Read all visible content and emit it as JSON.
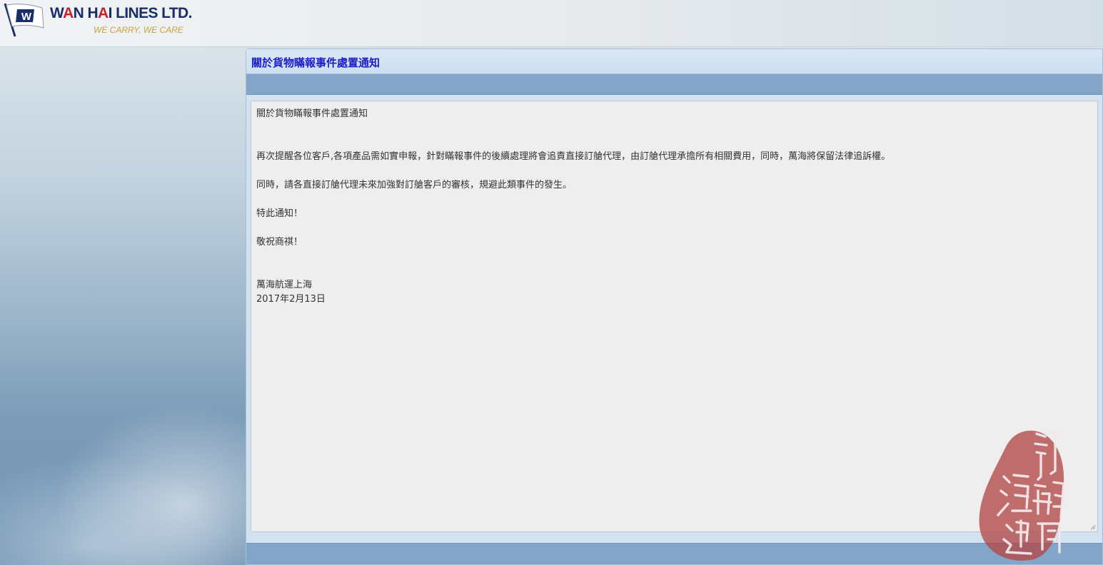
{
  "header": {
    "brand_parts": [
      "W",
      "A",
      "N H",
      "A",
      "I LINES LTD."
    ],
    "slogan": "WE CARRY, WE CARE",
    "brand_colors": {
      "navy": "#1a2d6b",
      "red": "#c8202c",
      "gold": "#c9a13f"
    }
  },
  "panel": {
    "title": "關於貨物瞞報事件處置通知",
    "title_color": "#1c1cc8"
  },
  "notice": {
    "heading": "關於貨物瞞報事件處置通知",
    "paragraph_1": "再次提醒各位客戶,各項產品需如實申報，針對瞞報事件的後續處理將會追責直接訂艙代理，由訂艙代理承擔所有相關費用，同時，萬海將保留法律追訴權。",
    "paragraph_2": "同時，請各直接訂艙代理未來加強對訂艙客戶的審核，規避此類事件的發生。",
    "closing_1": "特此通知！",
    "closing_2": "敬祝商祺！",
    "signature": "萬海航運上海",
    "date": "2017年2月13日"
  },
  "watermark": {
    "text": "訂艙網海運",
    "color": "#b24848"
  },
  "icons": {
    "logo": "wan-hai-flag-icon",
    "resize": "resize-grip-icon"
  }
}
